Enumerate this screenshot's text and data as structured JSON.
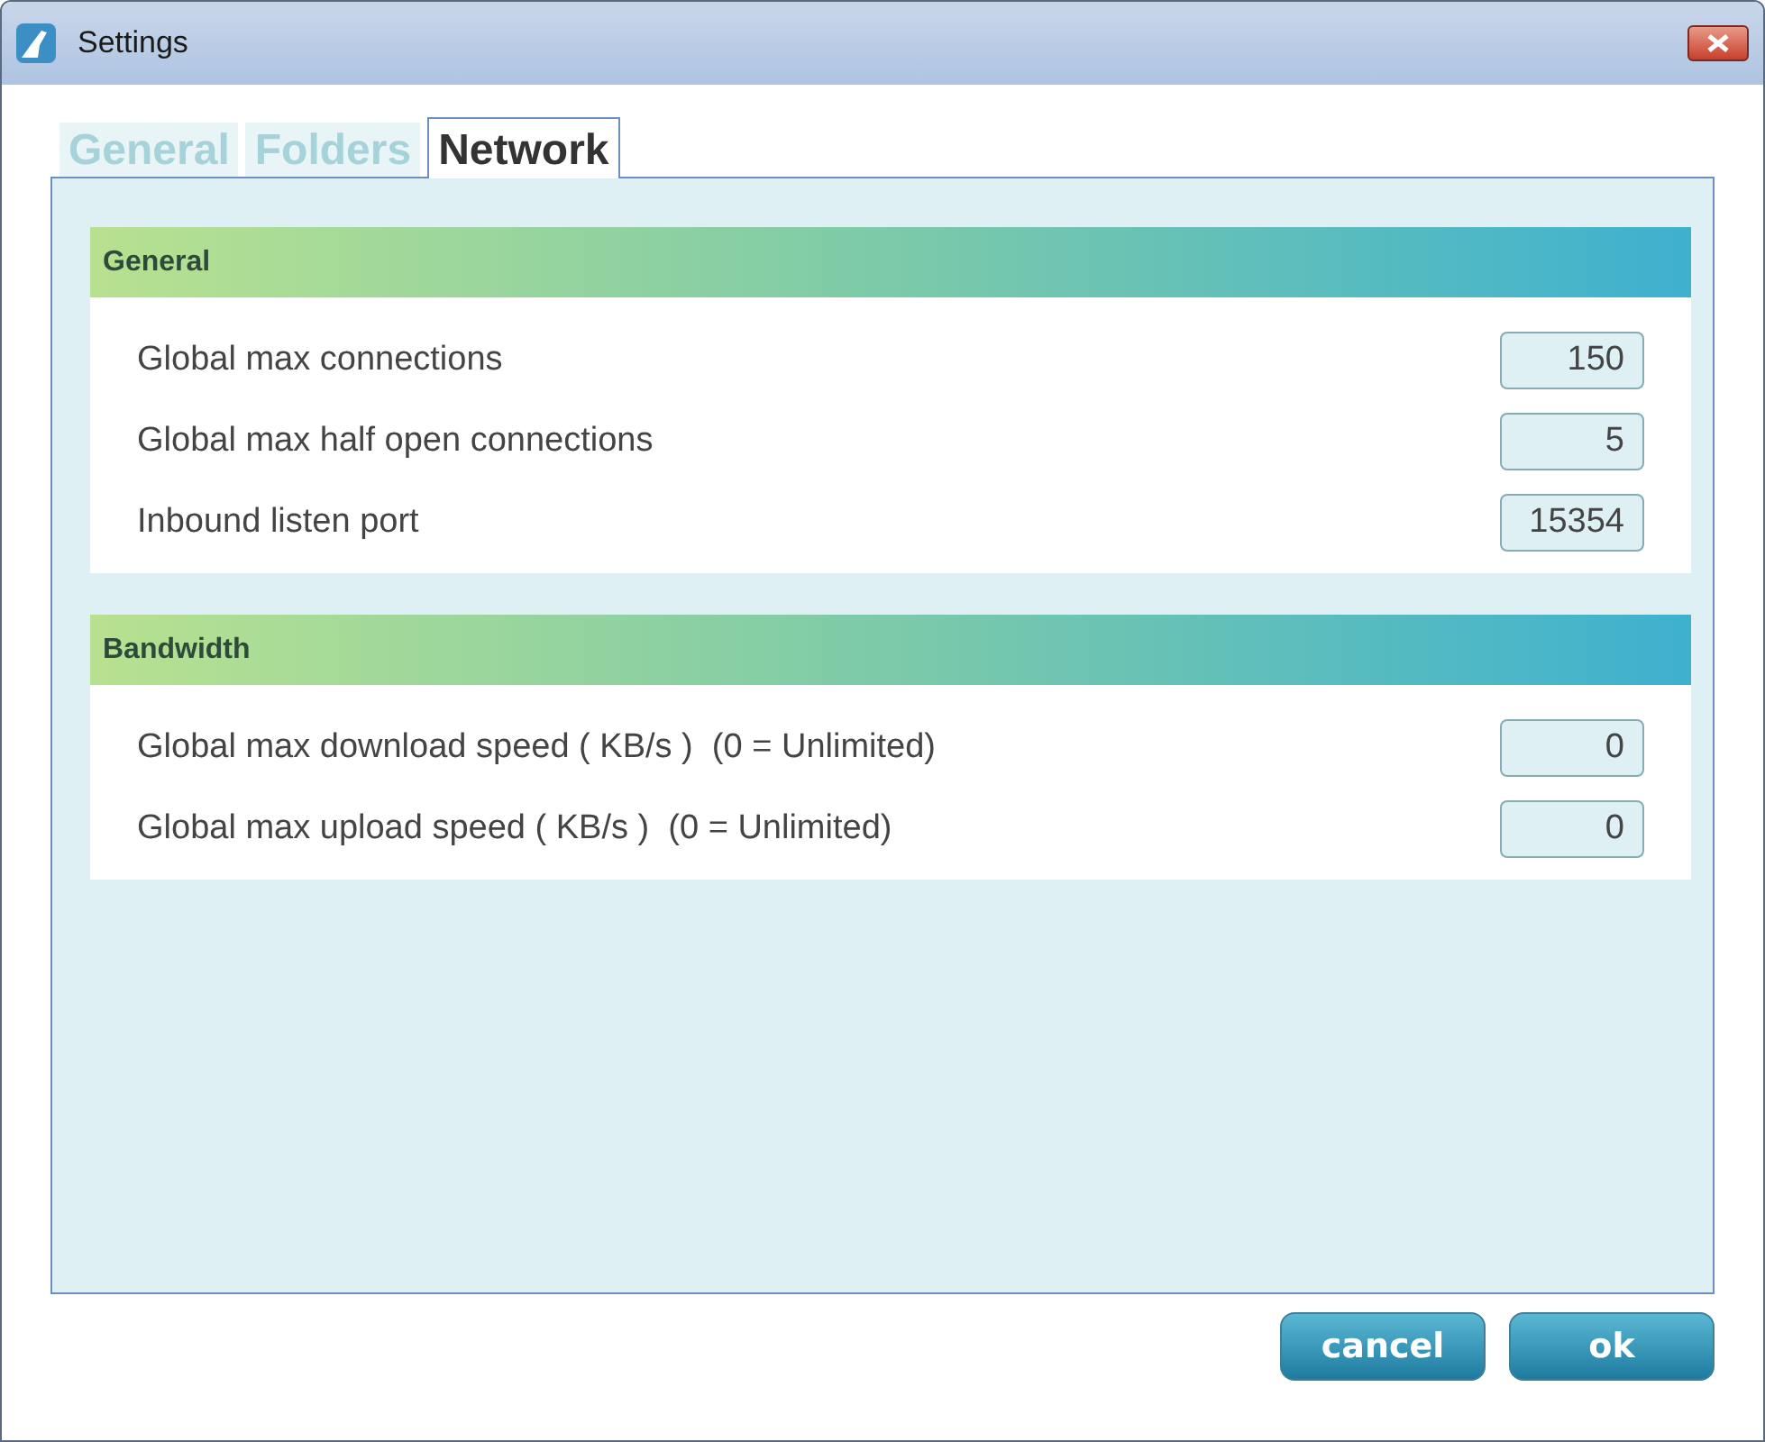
{
  "window": {
    "title": "Settings"
  },
  "tabs": [
    {
      "label": "General",
      "selected": false
    },
    {
      "label": "Folders",
      "selected": false
    },
    {
      "label": "Network",
      "selected": true
    }
  ],
  "sections": [
    {
      "title": "General",
      "rows": [
        {
          "label": "Global max connections",
          "value": "150"
        },
        {
          "label": "Global max half open connections",
          "value": "5"
        },
        {
          "label": "Inbound listen port",
          "value": "15354"
        }
      ]
    },
    {
      "title": "Bandwidth",
      "rows": [
        {
          "label": "Global max download speed ( KB/s )  (0 = Unlimited)",
          "value": "0"
        },
        {
          "label": "Global max upload speed ( KB/s )  (0 = Unlimited)",
          "value": "0"
        }
      ]
    }
  ],
  "buttons": [
    "cancel",
    "ok"
  ]
}
